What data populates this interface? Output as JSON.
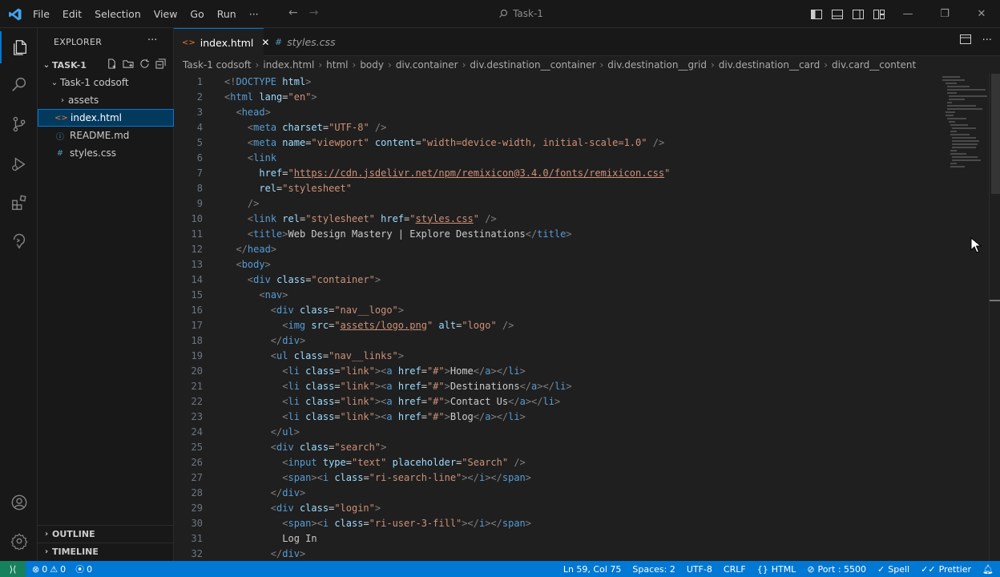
{
  "window": {
    "title": "Task-1",
    "menu": [
      "File",
      "Edit",
      "Selection",
      "View",
      "Go",
      "Run"
    ],
    "more": "···"
  },
  "sidebar": {
    "title": "EXPLORER",
    "more": "···",
    "root": "TASK-1",
    "folder": "Task-1 codsoft",
    "items": [
      {
        "label": "assets",
        "kind": "folder"
      },
      {
        "label": "index.html",
        "kind": "html",
        "icon": "<>"
      },
      {
        "label": "README.md",
        "kind": "info",
        "icon": "ⓘ"
      },
      {
        "label": "styles.css",
        "kind": "css",
        "icon": "#"
      }
    ],
    "outline": "OUTLINE",
    "timeline": "TIMELINE"
  },
  "tabs": [
    {
      "label": "index.html",
      "icon": "<>",
      "close": "✕"
    },
    {
      "label": "styles.css",
      "icon": "#"
    }
  ],
  "breadcrumbs": [
    "Task-1 codsoft",
    "index.html",
    "html",
    "body",
    "div.container",
    "div.destination__container",
    "div.destination__grid",
    "div.destination__card",
    "div.card__content"
  ],
  "code": {
    "lines": [
      [
        [
          "tag",
          "<!"
        ],
        [
          "dt",
          "DOCTYPE"
        ],
        [
          "tx",
          " "
        ],
        [
          "at",
          "html"
        ],
        [
          "tag",
          ">"
        ]
      ],
      [
        [
          "tag",
          "<"
        ],
        [
          "tn",
          "html"
        ],
        [
          "tx",
          " "
        ],
        [
          "at",
          "lang"
        ],
        [
          "tx",
          "="
        ],
        [
          "av",
          "\"en\""
        ],
        [
          "tag",
          ">"
        ]
      ],
      [
        [
          "tx",
          "  "
        ],
        [
          "tag",
          "<"
        ],
        [
          "tn",
          "head"
        ],
        [
          "tag",
          ">"
        ]
      ],
      [
        [
          "tx",
          "    "
        ],
        [
          "tag",
          "<"
        ],
        [
          "tn",
          "meta"
        ],
        [
          "tx",
          " "
        ],
        [
          "at",
          "charset"
        ],
        [
          "tx",
          "="
        ],
        [
          "av",
          "\"UTF-8\""
        ],
        [
          "tx",
          " "
        ],
        [
          "tag",
          "/>"
        ]
      ],
      [
        [
          "tx",
          "    "
        ],
        [
          "tag",
          "<"
        ],
        [
          "tn",
          "meta"
        ],
        [
          "tx",
          " "
        ],
        [
          "at",
          "name"
        ],
        [
          "tx",
          "="
        ],
        [
          "av",
          "\"viewport\""
        ],
        [
          "tx",
          " "
        ],
        [
          "at",
          "content"
        ],
        [
          "tx",
          "="
        ],
        [
          "av",
          "\"width=device-width, initial-scale=1.0\""
        ],
        [
          "tx",
          " "
        ],
        [
          "tag",
          "/>"
        ]
      ],
      [
        [
          "tx",
          "    "
        ],
        [
          "tag",
          "<"
        ],
        [
          "tn",
          "link"
        ]
      ],
      [
        [
          "tx",
          "      "
        ],
        [
          "at",
          "href"
        ],
        [
          "tx",
          "="
        ],
        [
          "av",
          "\""
        ],
        [
          "avu",
          "https://cdn.jsdelivr.net/npm/remixicon@3.4.0/fonts/remixicon.css"
        ],
        [
          "av",
          "\""
        ]
      ],
      [
        [
          "tx",
          "      "
        ],
        [
          "at",
          "rel"
        ],
        [
          "tx",
          "="
        ],
        [
          "av",
          "\"stylesheet\""
        ]
      ],
      [
        [
          "tx",
          "    "
        ],
        [
          "tag",
          "/>"
        ]
      ],
      [
        [
          "tx",
          "    "
        ],
        [
          "tag",
          "<"
        ],
        [
          "tn",
          "link"
        ],
        [
          "tx",
          " "
        ],
        [
          "at",
          "rel"
        ],
        [
          "tx",
          "="
        ],
        [
          "av",
          "\"stylesheet\""
        ],
        [
          "tx",
          " "
        ],
        [
          "at",
          "href"
        ],
        [
          "tx",
          "="
        ],
        [
          "av",
          "\""
        ],
        [
          "avu",
          "styles.css"
        ],
        [
          "av",
          "\""
        ],
        [
          "tx",
          " "
        ],
        [
          "tag",
          "/>"
        ]
      ],
      [
        [
          "tx",
          "    "
        ],
        [
          "tag",
          "<"
        ],
        [
          "tn",
          "title"
        ],
        [
          "tag",
          ">"
        ],
        [
          "tx",
          "Web Design Mastery | Explore Destinations"
        ],
        [
          "tag",
          "</"
        ],
        [
          "tn",
          "title"
        ],
        [
          "tag",
          ">"
        ]
      ],
      [
        [
          "tx",
          "  "
        ],
        [
          "tag",
          "</"
        ],
        [
          "tn",
          "head"
        ],
        [
          "tag",
          ">"
        ]
      ],
      [
        [
          "tx",
          "  "
        ],
        [
          "tag",
          "<"
        ],
        [
          "tn",
          "body"
        ],
        [
          "tag",
          ">"
        ]
      ],
      [
        [
          "tx",
          "    "
        ],
        [
          "tag",
          "<"
        ],
        [
          "tn",
          "div"
        ],
        [
          "tx",
          " "
        ],
        [
          "at",
          "class"
        ],
        [
          "tx",
          "="
        ],
        [
          "av",
          "\"container\""
        ],
        [
          "tag",
          ">"
        ]
      ],
      [
        [
          "tx",
          "      "
        ],
        [
          "tag",
          "<"
        ],
        [
          "tn",
          "nav"
        ],
        [
          "tag",
          ">"
        ]
      ],
      [
        [
          "tx",
          "        "
        ],
        [
          "tag",
          "<"
        ],
        [
          "tn",
          "div"
        ],
        [
          "tx",
          " "
        ],
        [
          "at",
          "class"
        ],
        [
          "tx",
          "="
        ],
        [
          "av",
          "\"nav__logo\""
        ],
        [
          "tag",
          ">"
        ]
      ],
      [
        [
          "tx",
          "          "
        ],
        [
          "tag",
          "<"
        ],
        [
          "tn",
          "img"
        ],
        [
          "tx",
          " "
        ],
        [
          "at",
          "src"
        ],
        [
          "tx",
          "="
        ],
        [
          "av",
          "\""
        ],
        [
          "avu",
          "assets/logo.png"
        ],
        [
          "av",
          "\""
        ],
        [
          "tx",
          " "
        ],
        [
          "at",
          "alt"
        ],
        [
          "tx",
          "="
        ],
        [
          "av",
          "\"logo\""
        ],
        [
          "tx",
          " "
        ],
        [
          "tag",
          "/>"
        ]
      ],
      [
        [
          "tx",
          "        "
        ],
        [
          "tag",
          "</"
        ],
        [
          "tn",
          "div"
        ],
        [
          "tag",
          ">"
        ]
      ],
      [
        [
          "tx",
          "        "
        ],
        [
          "tag",
          "<"
        ],
        [
          "tn",
          "ul"
        ],
        [
          "tx",
          " "
        ],
        [
          "at",
          "class"
        ],
        [
          "tx",
          "="
        ],
        [
          "av",
          "\"nav__links\""
        ],
        [
          "tag",
          ">"
        ]
      ],
      [
        [
          "tx",
          "          "
        ],
        [
          "tag",
          "<"
        ],
        [
          "tn",
          "li"
        ],
        [
          "tx",
          " "
        ],
        [
          "at",
          "class"
        ],
        [
          "tx",
          "="
        ],
        [
          "av",
          "\"link\""
        ],
        [
          "tag",
          "><"
        ],
        [
          "tn",
          "a"
        ],
        [
          "tx",
          " "
        ],
        [
          "at",
          "href"
        ],
        [
          "tx",
          "="
        ],
        [
          "av",
          "\"#\""
        ],
        [
          "tag",
          ">"
        ],
        [
          "tx",
          "Home"
        ],
        [
          "tag",
          "</"
        ],
        [
          "tn",
          "a"
        ],
        [
          "tag",
          "></"
        ],
        [
          "tn",
          "li"
        ],
        [
          "tag",
          ">"
        ]
      ],
      [
        [
          "tx",
          "          "
        ],
        [
          "tag",
          "<"
        ],
        [
          "tn",
          "li"
        ],
        [
          "tx",
          " "
        ],
        [
          "at",
          "class"
        ],
        [
          "tx",
          "="
        ],
        [
          "av",
          "\"link\""
        ],
        [
          "tag",
          "><"
        ],
        [
          "tn",
          "a"
        ],
        [
          "tx",
          " "
        ],
        [
          "at",
          "href"
        ],
        [
          "tx",
          "="
        ],
        [
          "av",
          "\"#\""
        ],
        [
          "tag",
          ">"
        ],
        [
          "tx",
          "Destinations"
        ],
        [
          "tag",
          "</"
        ],
        [
          "tn",
          "a"
        ],
        [
          "tag",
          "></"
        ],
        [
          "tn",
          "li"
        ],
        [
          "tag",
          ">"
        ]
      ],
      [
        [
          "tx",
          "          "
        ],
        [
          "tag",
          "<"
        ],
        [
          "tn",
          "li"
        ],
        [
          "tx",
          " "
        ],
        [
          "at",
          "class"
        ],
        [
          "tx",
          "="
        ],
        [
          "av",
          "\"link\""
        ],
        [
          "tag",
          "><"
        ],
        [
          "tn",
          "a"
        ],
        [
          "tx",
          " "
        ],
        [
          "at",
          "href"
        ],
        [
          "tx",
          "="
        ],
        [
          "av",
          "\"#\""
        ],
        [
          "tag",
          ">"
        ],
        [
          "tx",
          "Contact Us"
        ],
        [
          "tag",
          "</"
        ],
        [
          "tn",
          "a"
        ],
        [
          "tag",
          "></"
        ],
        [
          "tn",
          "li"
        ],
        [
          "tag",
          ">"
        ]
      ],
      [
        [
          "tx",
          "          "
        ],
        [
          "tag",
          "<"
        ],
        [
          "tn",
          "li"
        ],
        [
          "tx",
          " "
        ],
        [
          "at",
          "class"
        ],
        [
          "tx",
          "="
        ],
        [
          "av",
          "\"link\""
        ],
        [
          "tag",
          "><"
        ],
        [
          "tn",
          "a"
        ],
        [
          "tx",
          " "
        ],
        [
          "at",
          "href"
        ],
        [
          "tx",
          "="
        ],
        [
          "av",
          "\"#\""
        ],
        [
          "tag",
          ">"
        ],
        [
          "tx",
          "Blog"
        ],
        [
          "tag",
          "</"
        ],
        [
          "tn",
          "a"
        ],
        [
          "tag",
          "></"
        ],
        [
          "tn",
          "li"
        ],
        [
          "tag",
          ">"
        ]
      ],
      [
        [
          "tx",
          "        "
        ],
        [
          "tag",
          "</"
        ],
        [
          "tn",
          "ul"
        ],
        [
          "tag",
          ">"
        ]
      ],
      [
        [
          "tx",
          "        "
        ],
        [
          "tag",
          "<"
        ],
        [
          "tn",
          "div"
        ],
        [
          "tx",
          " "
        ],
        [
          "at",
          "class"
        ],
        [
          "tx",
          "="
        ],
        [
          "av",
          "\"search\""
        ],
        [
          "tag",
          ">"
        ]
      ],
      [
        [
          "tx",
          "          "
        ],
        [
          "tag",
          "<"
        ],
        [
          "tn",
          "input"
        ],
        [
          "tx",
          " "
        ],
        [
          "at",
          "type"
        ],
        [
          "tx",
          "="
        ],
        [
          "av",
          "\"text\""
        ],
        [
          "tx",
          " "
        ],
        [
          "at",
          "placeholder"
        ],
        [
          "tx",
          "="
        ],
        [
          "av",
          "\"Search\""
        ],
        [
          "tx",
          " "
        ],
        [
          "tag",
          "/>"
        ]
      ],
      [
        [
          "tx",
          "          "
        ],
        [
          "tag",
          "<"
        ],
        [
          "tn",
          "span"
        ],
        [
          "tag",
          "><"
        ],
        [
          "tn",
          "i"
        ],
        [
          "tx",
          " "
        ],
        [
          "at",
          "class"
        ],
        [
          "tx",
          "="
        ],
        [
          "av",
          "\"ri-search-line\""
        ],
        [
          "tag",
          "></"
        ],
        [
          "tn",
          "i"
        ],
        [
          "tag",
          "></"
        ],
        [
          "tn",
          "span"
        ],
        [
          "tag",
          ">"
        ]
      ],
      [
        [
          "tx",
          "        "
        ],
        [
          "tag",
          "</"
        ],
        [
          "tn",
          "div"
        ],
        [
          "tag",
          ">"
        ]
      ],
      [
        [
          "tx",
          "        "
        ],
        [
          "tag",
          "<"
        ],
        [
          "tn",
          "div"
        ],
        [
          "tx",
          " "
        ],
        [
          "at",
          "class"
        ],
        [
          "tx",
          "="
        ],
        [
          "av",
          "\"login\""
        ],
        [
          "tag",
          ">"
        ]
      ],
      [
        [
          "tx",
          "          "
        ],
        [
          "tag",
          "<"
        ],
        [
          "tn",
          "span"
        ],
        [
          "tag",
          "><"
        ],
        [
          "tn",
          "i"
        ],
        [
          "tx",
          " "
        ],
        [
          "at",
          "class"
        ],
        [
          "tx",
          "="
        ],
        [
          "av",
          "\"ri-user-3-fill\""
        ],
        [
          "tag",
          "></"
        ],
        [
          "tn",
          "i"
        ],
        [
          "tag",
          "></"
        ],
        [
          "tn",
          "span"
        ],
        [
          "tag",
          ">"
        ]
      ],
      [
        [
          "tx",
          "          Log In"
        ]
      ],
      [
        [
          "tx",
          "        "
        ],
        [
          "tag",
          "</"
        ],
        [
          "tn",
          "div"
        ],
        [
          "tag",
          ">"
        ]
      ]
    ]
  },
  "status": {
    "errors": "0",
    "warnings": "0",
    "ports": "0",
    "position": "Ln 59, Col 75",
    "spaces": "Spaces: 2",
    "encoding": "UTF-8",
    "eol": "CRLF",
    "language": "HTML",
    "port": "Port : 5500",
    "spell": "Spell",
    "prettier": "Prettier"
  },
  "colors": {
    "accent": "#0078d4",
    "remote": "#16825d",
    "selection": "#04395e"
  }
}
